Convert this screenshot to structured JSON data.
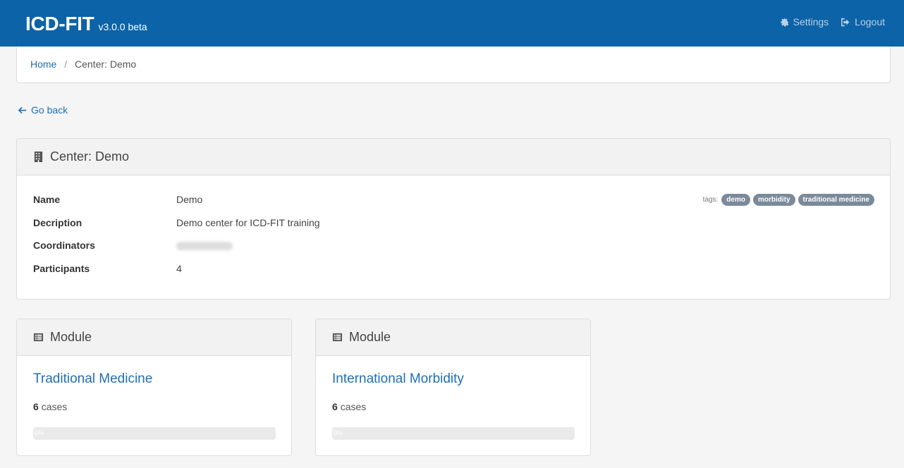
{
  "navbar": {
    "brand": "ICD-FIT",
    "version": "v3.0.0 beta",
    "settings_label": "Settings",
    "logout_label": "Logout"
  },
  "breadcrumb": {
    "home": "Home",
    "separator": "/",
    "current": "Center: Demo"
  },
  "go_back_label": "Go back",
  "center": {
    "heading": "Center: Demo",
    "fields": [
      {
        "label": "Name",
        "value": "Demo"
      },
      {
        "label": "Decription",
        "value": "Demo center for ICD-FIT training"
      },
      {
        "label": "Coordinators",
        "value": ""
      },
      {
        "label": "Participants",
        "value": "4"
      }
    ],
    "tags_label": "tags:",
    "tags": [
      "demo",
      "morbidity",
      "traditional medicine"
    ]
  },
  "modules": [
    {
      "heading": "Module",
      "title": "Traditional Medicine",
      "cases_count": "6",
      "cases_label": "cases",
      "progress_label": "0%",
      "progress": 0
    },
    {
      "heading": "Module",
      "title": "International Morbidity",
      "cases_count": "6",
      "cases_label": "cases",
      "progress_label": "0%",
      "progress": 0
    }
  ],
  "colors": {
    "navbar": "#0c63a7",
    "link": "#1f6fb5",
    "tag": "#7b8a9b"
  }
}
